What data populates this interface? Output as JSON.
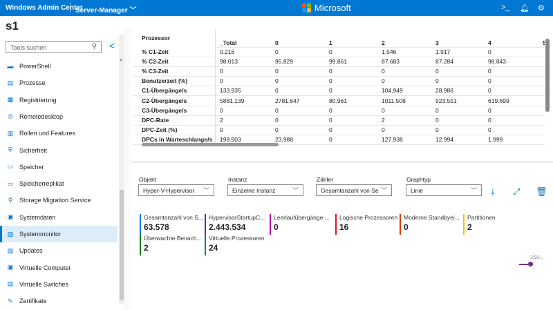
{
  "header": {
    "app_title": "Windows Admin Center",
    "context": "Server-Manager",
    "brand": "Microsoft",
    "icons": [
      "terminal-icon",
      "bell-icon",
      "gear-icon"
    ]
  },
  "host": "s1",
  "sidebar": {
    "search_placeholder": "Tools suchen",
    "items": [
      {
        "label": "PowerShell",
        "icon": "powershell-icon"
      },
      {
        "label": "Prozesse",
        "icon": "processes-icon"
      },
      {
        "label": "Registrierung",
        "icon": "registry-icon"
      },
      {
        "label": "Remotedesktop",
        "icon": "remote-desktop-icon"
      },
      {
        "label": "Rollen und Features",
        "icon": "roles-icon"
      },
      {
        "label": "Sicherheit",
        "icon": "shield-icon"
      },
      {
        "label": "Speicher",
        "icon": "storage-icon"
      },
      {
        "label": "Speicherreplikat",
        "icon": "storage-replica-icon"
      },
      {
        "label": "Storage Migration Service",
        "icon": "migration-icon"
      },
      {
        "label": "Systemdaten",
        "icon": "system-data-icon"
      },
      {
        "label": "Systemmonitor",
        "icon": "performance-monitor-icon",
        "active": true
      },
      {
        "label": "Updates",
        "icon": "updates-icon"
      },
      {
        "label": "Virtuelle Computer",
        "icon": "vm-icon"
      },
      {
        "label": "Virtuelle Switches",
        "icon": "switch-icon"
      },
      {
        "label": "Zertifikate",
        "icon": "certificate-icon"
      }
    ]
  },
  "table": {
    "object_header": "Prozessor",
    "columns": [
      "_Total",
      "0",
      "1",
      "2",
      "3",
      "4",
      "5"
    ],
    "rows": [
      {
        "label": "% C1-Zeit",
        "values": [
          "0.216",
          "0",
          "0",
          "1.546",
          "1.917",
          "0"
        ]
      },
      {
        "label": "% C2-Zeit",
        "values": [
          "98.013",
          "95.829",
          "99.861",
          "87.683",
          "87.284",
          "98.843"
        ]
      },
      {
        "label": "% C3-Zeit",
        "values": [
          "0",
          "0",
          "0",
          "0",
          "0",
          "0"
        ]
      },
      {
        "label": "Benutzerzeit (%)",
        "values": [
          "0",
          "0",
          "0",
          "0",
          "0",
          "0"
        ]
      },
      {
        "label": "C1-Übergänge/s",
        "values": [
          "133.935",
          "0",
          "0",
          "104.949",
          "28.986",
          "0"
        ]
      },
      {
        "label": "C2-Übergänge/s",
        "values": [
          "5881.139",
          "2781.647",
          "80.961",
          "1011.508",
          "923.551",
          "619.699"
        ]
      },
      {
        "label": "C3-Übergänge/s",
        "values": [
          "0",
          "0",
          "0",
          "0",
          "0",
          "0"
        ]
      },
      {
        "label": "DPC-Rate",
        "values": [
          "2",
          "0",
          "0",
          "2",
          "0",
          "0"
        ]
      },
      {
        "label": "DPC-Zeit (%)",
        "values": [
          "0",
          "0",
          "0",
          "0",
          "0",
          "0"
        ]
      },
      {
        "label": "DPCs in Warteschlange/s",
        "values": [
          "198.903",
          "23.988",
          "0",
          "127.938",
          "12.994",
          "1.999"
        ]
      }
    ]
  },
  "controls": {
    "object_label": "Objekt",
    "object_value": "Hyper-V-Hypervisor",
    "instance_label": "Instanz",
    "instance_value": "Einzelne Instanz",
    "counter_label": "Zähler",
    "counter_value": "Gesamtanzahl von Se",
    "graph_label": "Graphtyp",
    "graph_value": "Linie"
  },
  "stats": [
    {
      "name": "Gesamtanzahl von S...",
      "value": "63.578",
      "color": "#0078d4"
    },
    {
      "name": "HypervisorStartupC...",
      "value": "2.443.534",
      "color": "#5c2d91"
    },
    {
      "name": "Leerlaufübergänge ...",
      "value": "0",
      "color": "#b4009e"
    },
    {
      "name": "Logische Prozessoren",
      "value": "16",
      "color": "#e81123"
    },
    {
      "name": "Moderne Standbyei...",
      "value": "0",
      "color": "#d83b01"
    },
    {
      "name": "Partitionen",
      "value": "2",
      "color": "#ffb900"
    },
    {
      "name": "Überwachte Benach...",
      "value": "2",
      "color": "#107c10"
    },
    {
      "name": "Virtuelle Prozessoren",
      "value": "24",
      "color": "#008272"
    }
  ],
  "chart": {
    "last_value_label": "2.93..."
  }
}
